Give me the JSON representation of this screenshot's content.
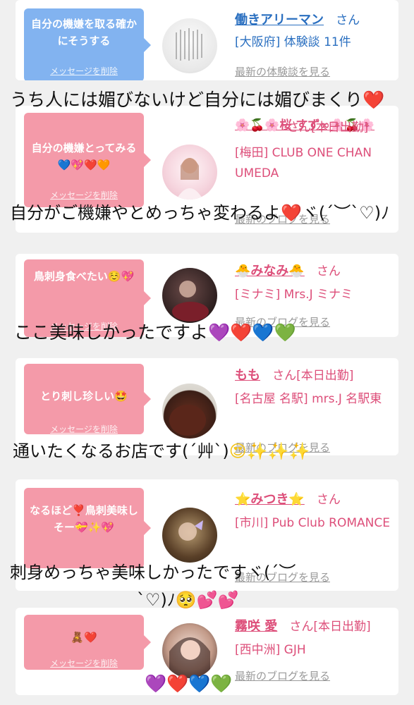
{
  "cards": [
    {
      "bubble_color": "blue",
      "message": "自分の機嫌を取る確かにそうする",
      "delete_label": "メッセージを削除",
      "name": "働きアリーマン",
      "san": "さん",
      "location": "[大阪府] 体験談 11件",
      "more_label": "最新の体験談を見る",
      "accent": "#2a6fc0"
    },
    {
      "bubble_color": "pink",
      "message": "自分の機嫌とってみる💙💖❤️🧡",
      "delete_label": "メッセージを削除",
      "name": "🌸🍒🌸桜 すず∞🌸🍒🌸",
      "san": "さん[本日出勤]",
      "location": "[梅田] CLUB ONE CHAN UMEDA",
      "more_label": "最新のブログを見る",
      "accent": "#dd4f7a"
    },
    {
      "bubble_color": "pink",
      "message": "鳥刺身食べたい☺️💖",
      "delete_label": "メッセージを削除",
      "name": "🐣みなみ🐣",
      "san": "さん",
      "location": "[ミナミ] Mrs.J ミナミ",
      "more_label": "最新のブログを見る",
      "accent": "#dd4f7a"
    },
    {
      "bubble_color": "pink",
      "message": "とり刺し珍しい🤩",
      "delete_label": "メッセージを削除",
      "name": "もも",
      "san": "さん[本日出勤]",
      "location": "[名古屋 名駅] mrs.J 名駅東",
      "more_label": "最新のブログを見る",
      "accent": "#dd4f7a"
    },
    {
      "bubble_color": "pink",
      "message": "なるほど❣️鳥刺美味しそー💝✨💖",
      "delete_label": "メッセージを削除",
      "name": "⭐みつき⭐",
      "san": "さん",
      "location": "[市川] Pub Club ROMANCE",
      "more_label": "最新のブログを見る",
      "accent": "#dd4f7a"
    },
    {
      "bubble_color": "pink",
      "message": "🧸❤️",
      "delete_label": "メッセージを削除",
      "name": "霧咲 愛",
      "san": "さん[本日出勤]",
      "location": "[西中洲] GJH",
      "more_label": "最新のブログを見る",
      "accent": "#dd4f7a"
    }
  ],
  "captions": [
    {
      "text": "うち人には媚びないけど自分には媚びまくり",
      "heart": "❤️"
    },
    {
      "text": "自分がご機嫌やとめっちゃ変わるよ",
      "heart": "❤️",
      "tail": "ヾ(´︶`♡)ﾉ"
    },
    {
      "text": "ここ美味しかったですよ",
      "hearts": [
        "💜",
        "❤️",
        "💙",
        "💚"
      ]
    },
    {
      "text": "通いたくなるお店です(´艸`)",
      "tail": "😍✨✨✨"
    },
    {
      "text": "刺身めっちゃ美味しかったですヾ(´︶",
      "line2": "`♡)ﾉ🥺💕💕"
    },
    {
      "hearts": [
        "💜",
        "❤️",
        "💙",
        "💚"
      ]
    }
  ]
}
